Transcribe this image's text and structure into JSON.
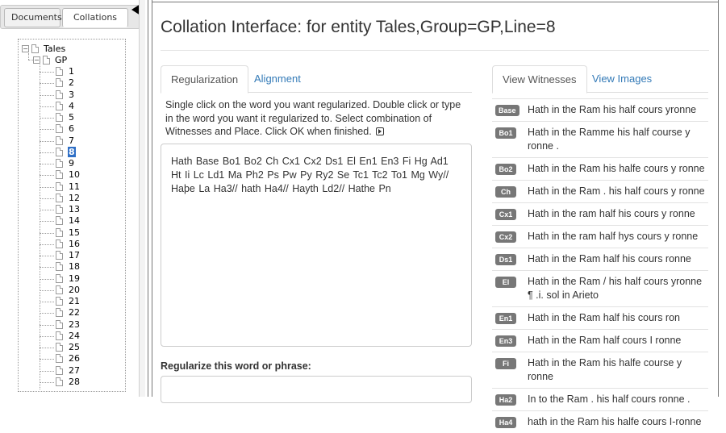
{
  "sidebar": {
    "tabs": [
      {
        "label": "Documents",
        "active": false
      },
      {
        "label": "Collations",
        "active": true
      }
    ],
    "tree": {
      "root": "Tales",
      "group": "GP",
      "lines": [
        "1",
        "2",
        "3",
        "4",
        "5",
        "6",
        "7",
        "8",
        "9",
        "10",
        "11",
        "12",
        "13",
        "14",
        "15",
        "16",
        "17",
        "18",
        "19",
        "20",
        "21",
        "22",
        "23",
        "24",
        "25",
        "26",
        "27",
        "28"
      ],
      "selected": "8"
    }
  },
  "main": {
    "title": "Collation Interface: for entity Tales,Group=GP,Line=8",
    "tabs": [
      {
        "label": "Regularization",
        "active": true
      },
      {
        "label": "Alignment",
        "active": false
      }
    ],
    "instructions": "Single click on the word you want regularized. Double click or type in the word you want it regularized to. Select combination of Witnesses and Place. Click OK when finished.",
    "witness_text": "Hath  Base Bo1 Bo2 Ch Cx1 Cx2 Ds1 El En1 En3 Fi Hg Ad1 Ht Ii Lc Ld1 Ma Ph2 Ps Pw Py Ry2 Se Tc1 Tc2 To1 Mg Wy// Haþe  La Ha3// hath  Ha4// Hayth  Ld2// Hathe  Pn",
    "regularize_label": "Regularize this word or phrase:"
  },
  "right": {
    "tabs": [
      {
        "label": "View Witnesses",
        "active": true
      },
      {
        "label": "View Images",
        "active": false
      }
    ],
    "witnesses": [
      {
        "siglum": "Base",
        "text": "Hath in the Ram his half cours yronne"
      },
      {
        "siglum": "Bo1",
        "text": "Hath in the Ramme his half course y ronne ."
      },
      {
        "siglum": "Bo2",
        "text": "Hath in the Ram his halfe cours y ronne"
      },
      {
        "siglum": "Ch",
        "text": "Hath in the Ram . his half cours y ronne"
      },
      {
        "siglum": "Cx1",
        "text": "Hath in the ram half his cours y ronne"
      },
      {
        "siglum": "Cx2",
        "text": "Hath in the ram half hys cours y ronne"
      },
      {
        "siglum": "Ds1",
        "text": "Hath in the Ram half his cours ronne"
      },
      {
        "siglum": "El",
        "text": "Hath in the Ram / his half cours yronne ¶ .i. sol in Arieto"
      },
      {
        "siglum": "En1",
        "text": "Hath in the Ram half his cours ron"
      },
      {
        "siglum": "En3",
        "text": "Hath in the Ram half cours I ronne"
      },
      {
        "siglum": "Fi",
        "text": "Hath in the Ram his halfe course y ronne"
      },
      {
        "siglum": "Ha2",
        "text": "In to the Ram . his half cours ronne ."
      },
      {
        "siglum": "Ha4",
        "text": "hath in the Ram his halfe cours I-ronne"
      }
    ]
  }
}
